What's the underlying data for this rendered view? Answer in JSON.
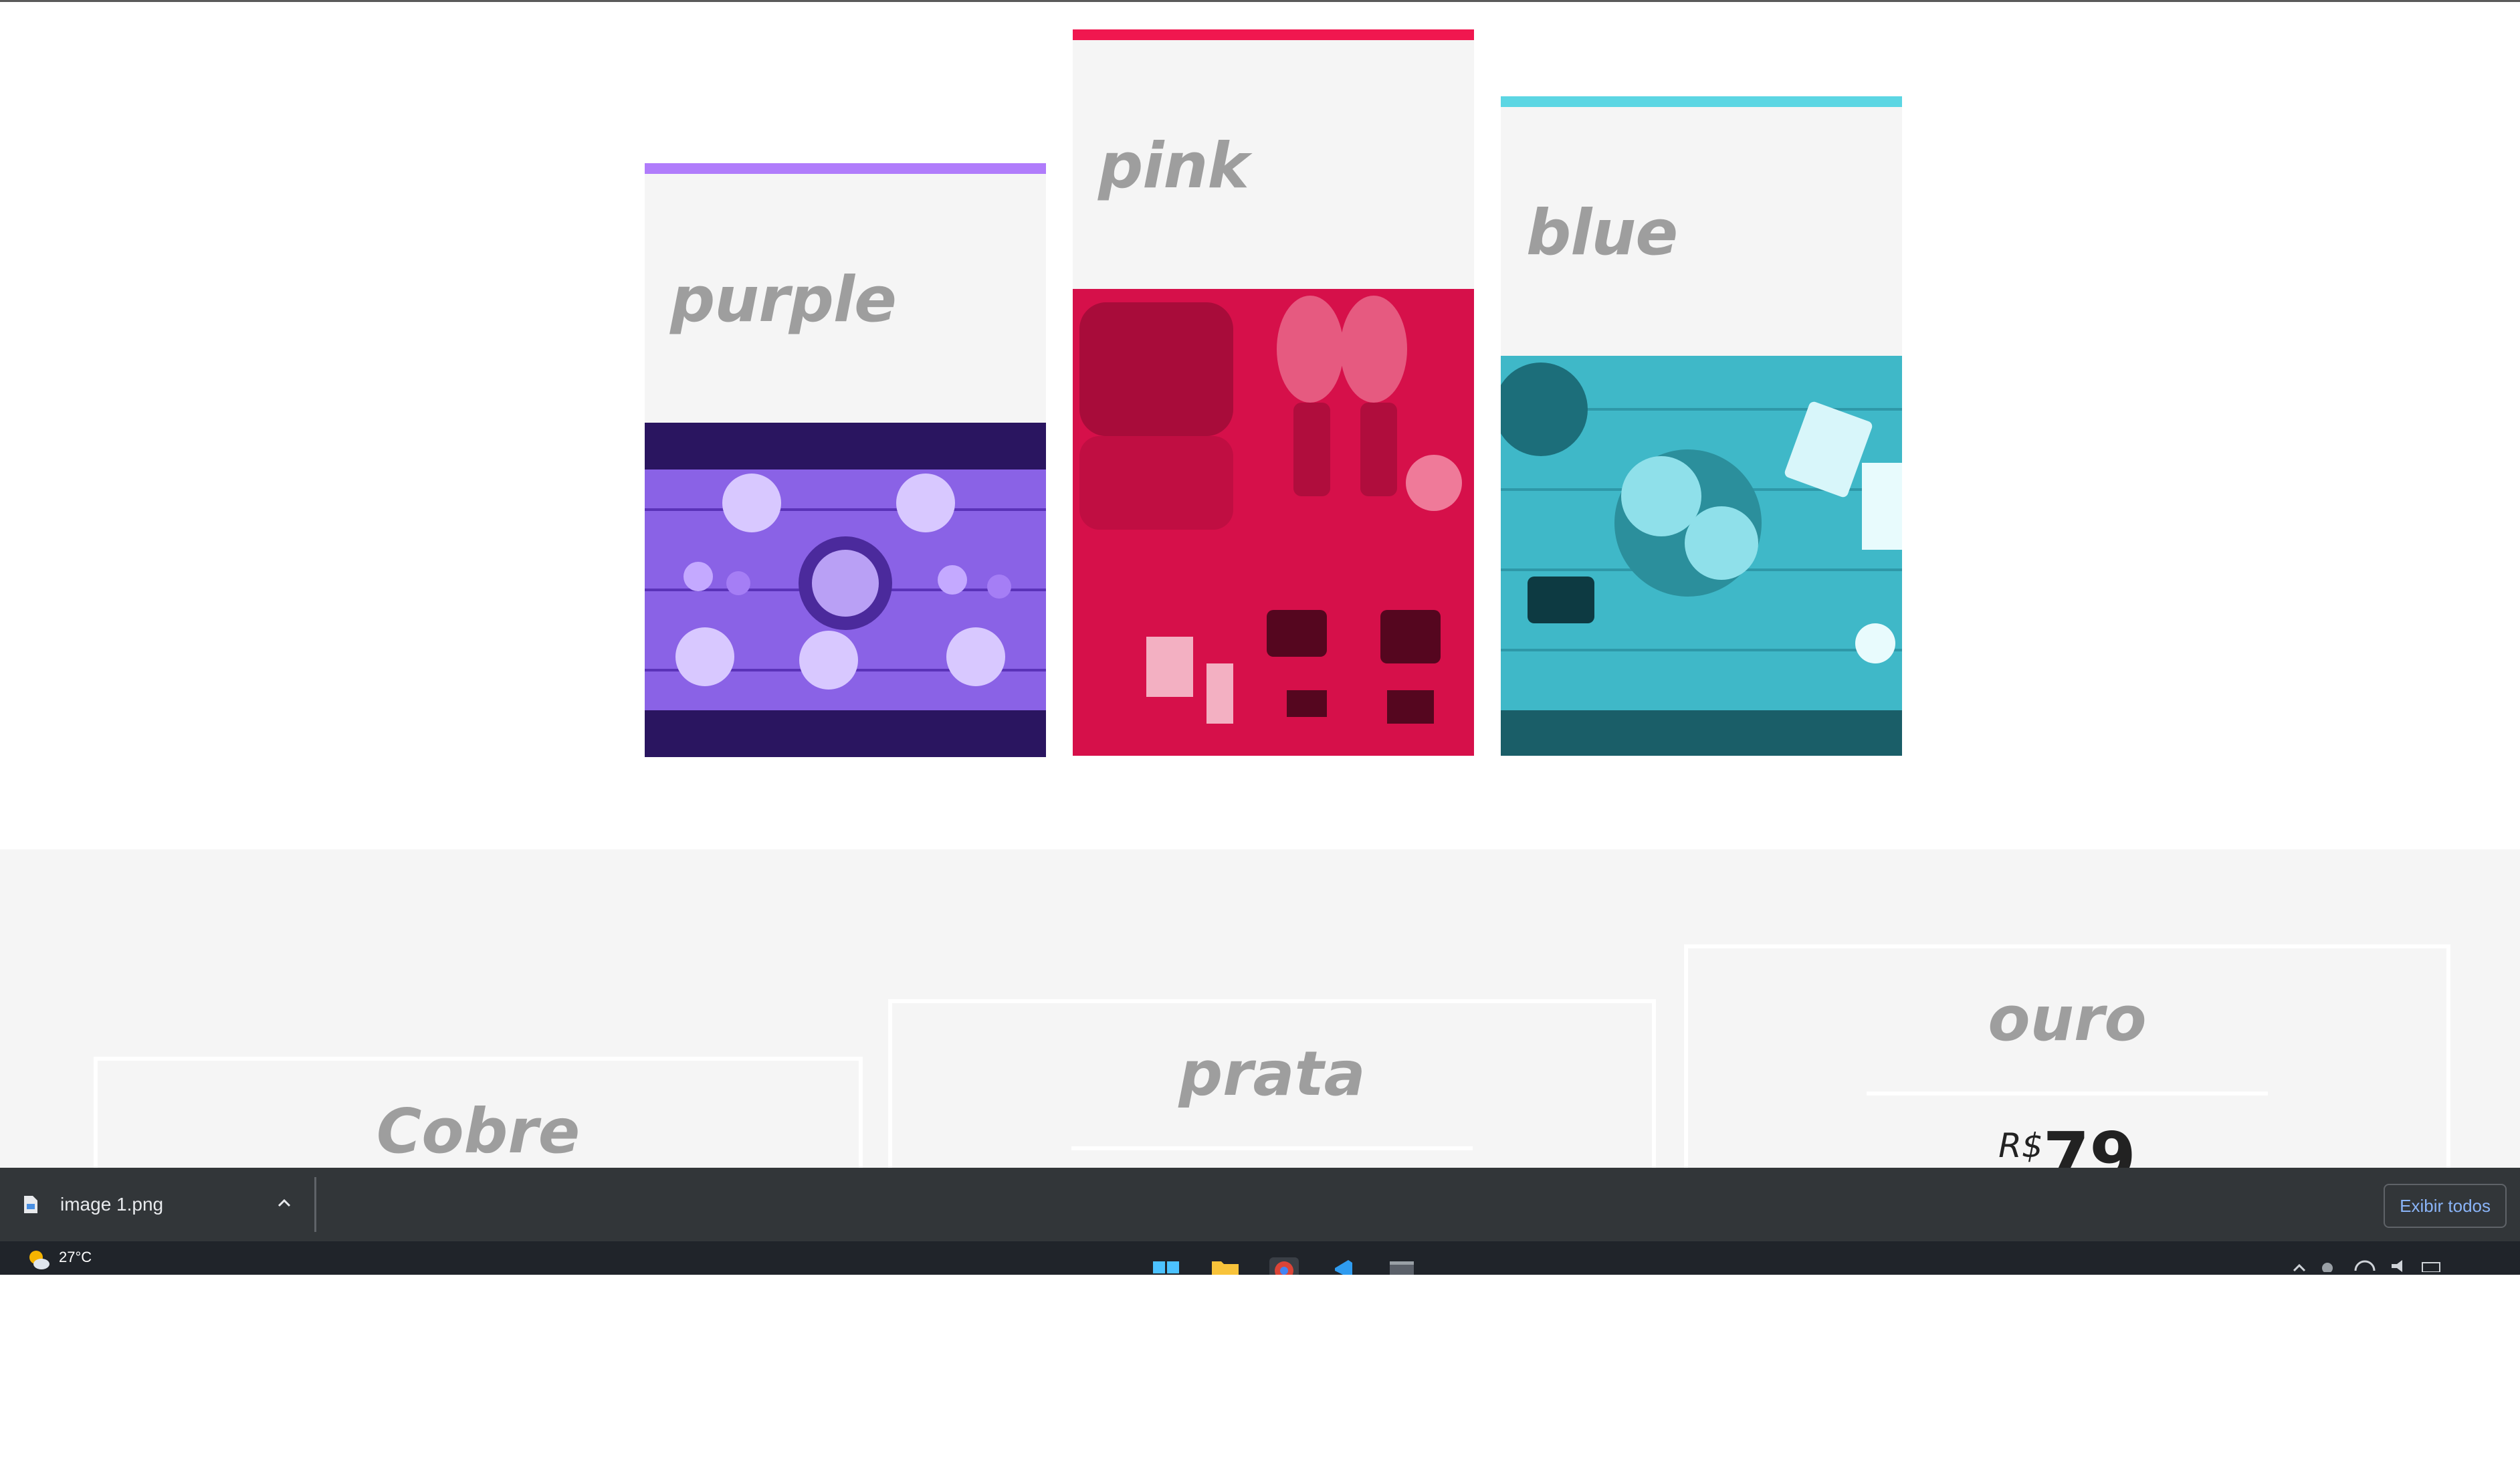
{
  "cards": [
    {
      "title": "purple",
      "accent": "#b07cfb",
      "photo": "table-setting-photo"
    },
    {
      "title": "pink",
      "accent": "#f0174f",
      "photo": "hiking-gear-photo"
    },
    {
      "title": "blue",
      "accent": "#5cd6e3",
      "photo": "flowers-desk-photo"
    }
  ],
  "plans": [
    {
      "name": "Cobre"
    },
    {
      "name": "prata"
    },
    {
      "name": "ouro",
      "currency": "R$",
      "price": "79"
    }
  ],
  "download_bar": {
    "file_name": "image 1.png",
    "show_all_label": "Exibir todos"
  },
  "taskbar": {
    "weather_temp": "27°C",
    "apps": [
      "start-icon",
      "file-explorer-icon",
      "chrome-icon",
      "vscode-icon",
      "terminal-icon"
    ]
  }
}
